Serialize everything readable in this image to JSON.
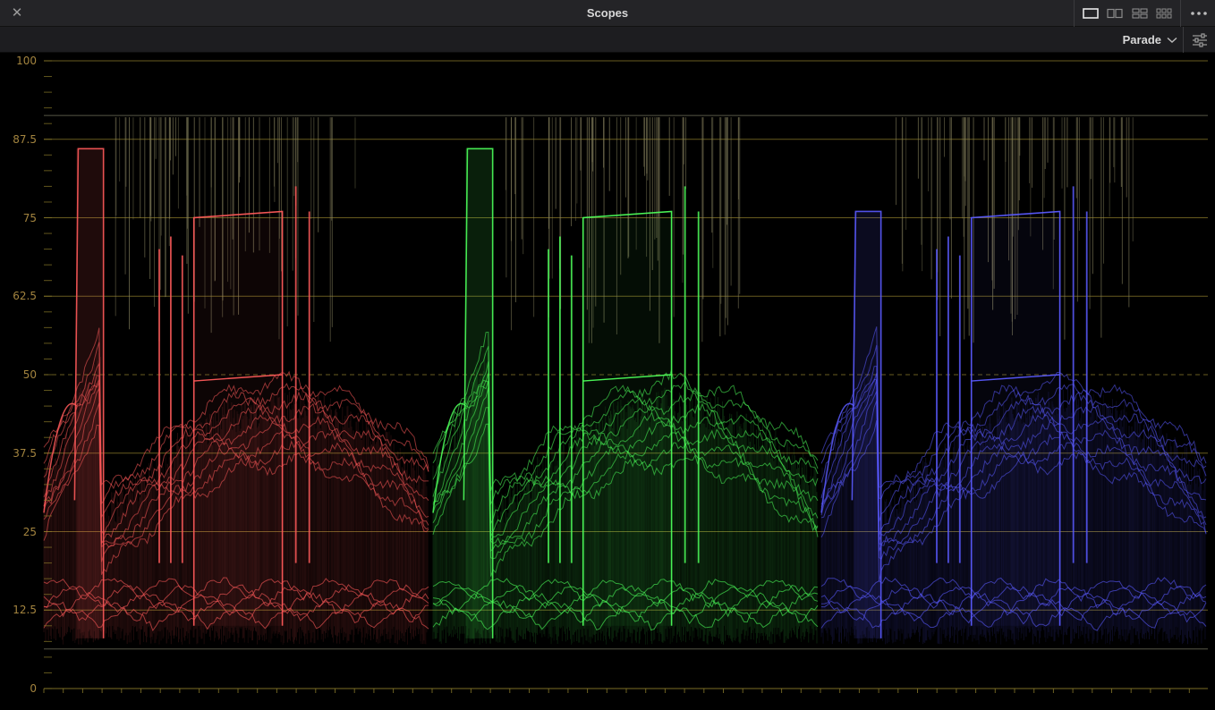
{
  "window": {
    "title": "Scopes",
    "close_glyph": "✕",
    "close_icon": "close-icon",
    "layout_icons": [
      "single-view-icon",
      "dual-view-icon",
      "quad-view-icon",
      "six-view-icon"
    ],
    "more_icon": "more-options-icon"
  },
  "toolbar": {
    "mode": "Parade",
    "dropdown_icon": "chevron-down-icon",
    "settings_icon": "scope-settings-icon"
  },
  "scope": {
    "y_ticks": [
      "100",
      "87.5",
      "75",
      "62.5",
      "50",
      "37.5",
      "25",
      "12.5",
      "0"
    ],
    "y_values": [
      100,
      87.5,
      75,
      62.5,
      50,
      37.5,
      25,
      12.5,
      0
    ],
    "channels": [
      {
        "name": "red",
        "color": "#ff5a5a"
      },
      {
        "name": "green",
        "color": "#4dff5a"
      },
      {
        "name": "blue",
        "color": "#5a5aff"
      }
    ],
    "colors": {
      "graticule": "#8a7a2a",
      "label": "#a3843f",
      "limit": "#6b6b58"
    }
  }
}
